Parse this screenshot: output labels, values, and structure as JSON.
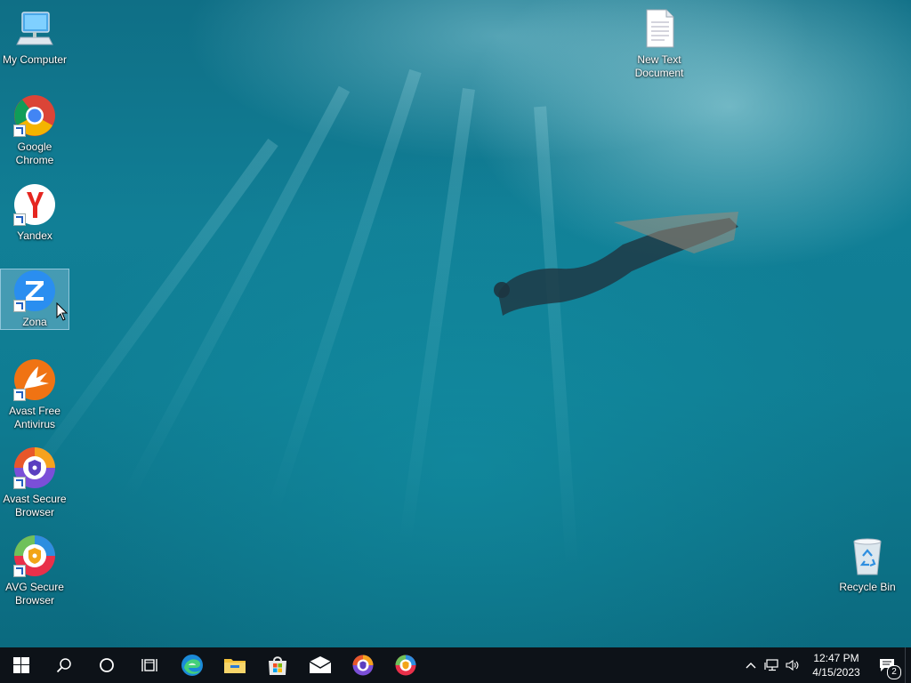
{
  "desktop": {
    "icons_left": [
      {
        "name": "my-computer",
        "label": "My Computer"
      },
      {
        "name": "google-chrome",
        "label": "Google\nChrome"
      },
      {
        "name": "yandex",
        "label": "Yandex"
      },
      {
        "name": "zona",
        "label": "Zona"
      },
      {
        "name": "avast-free-antivirus",
        "label": "Avast Free\nAntivirus"
      },
      {
        "name": "avast-secure-browser",
        "label": "Avast Secure\nBrowser"
      },
      {
        "name": "avg-secure-browser",
        "label": "AVG Secure\nBrowser"
      }
    ],
    "new_text_document": {
      "label": "New Text\nDocument"
    },
    "recycle_bin": {
      "label": "Recycle Bin"
    },
    "selected_icon": "Zona"
  },
  "taskbar": {
    "pinned": [
      "start-icon",
      "search-icon",
      "cortana-icon",
      "task-view-icon",
      "edge-icon",
      "file-explorer-icon",
      "store-icon",
      "mail-icon",
      "avast-secure-browser-icon",
      "avg-secure-browser-icon"
    ],
    "tray": {
      "time": "12:47 PM",
      "date": "4/15/2023",
      "notification_count": "2"
    }
  },
  "colors": {
    "taskbar": "#0d1218",
    "water": "#117f96",
    "selection": "#aad2eb"
  }
}
